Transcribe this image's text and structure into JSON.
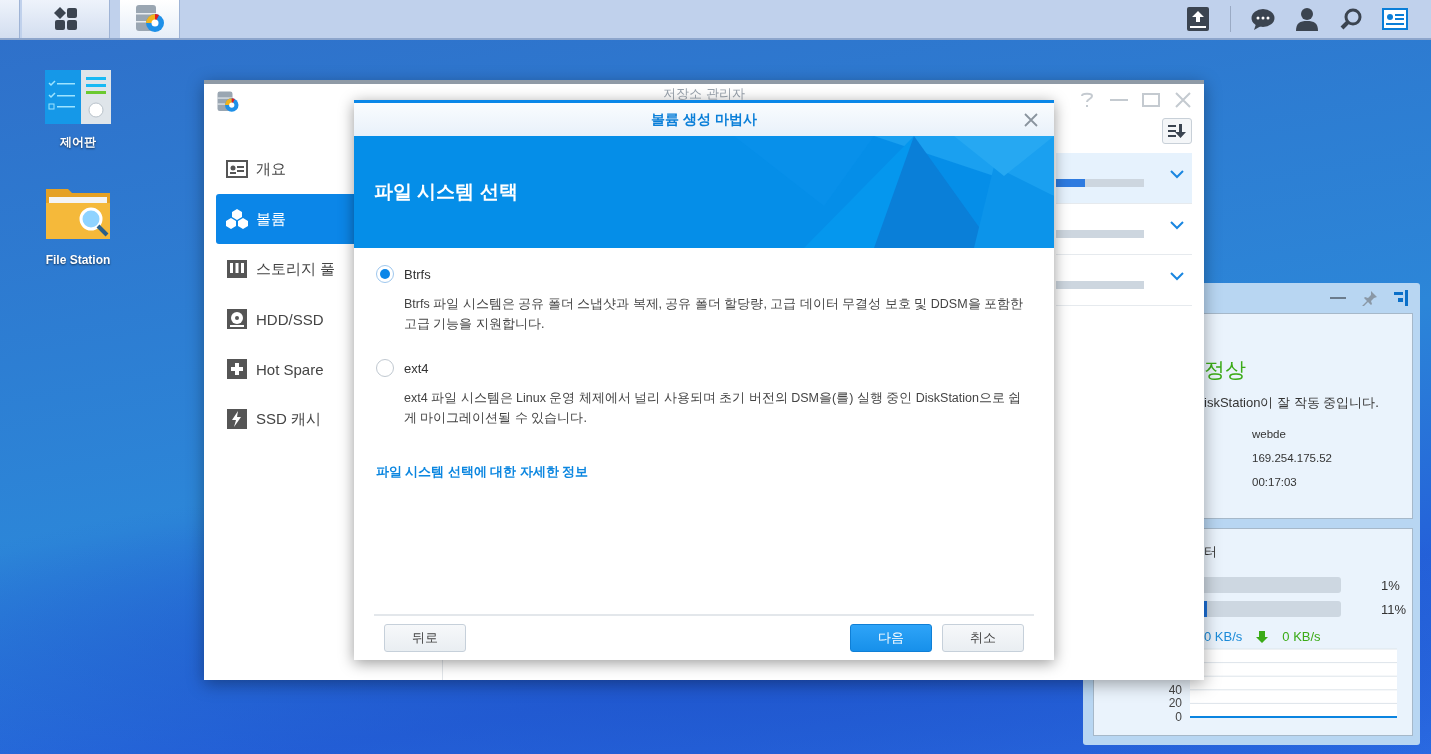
{
  "desktop_icons": [
    {
      "kind": "control-panel",
      "label": "제어판"
    },
    {
      "kind": "file-station",
      "label": "File Station"
    }
  ],
  "storage_window": {
    "title": "저장소 관리자",
    "sidebar": [
      {
        "kind": "overview",
        "label": "개요",
        "selected": false
      },
      {
        "kind": "volume",
        "label": "볼륨",
        "selected": true
      },
      {
        "kind": "pool",
        "label": "스토리지 풀",
        "selected": false
      },
      {
        "kind": "hdd",
        "label": "HDD/SSD",
        "selected": false
      },
      {
        "kind": "spare",
        "label": "Hot Spare",
        "selected": false
      },
      {
        "kind": "cache",
        "label": "SSD 캐시",
        "selected": false
      }
    ],
    "volumes": [
      {
        "level": 0.33,
        "selected": true
      },
      {
        "selected": false
      },
      {
        "selected": false
      }
    ]
  },
  "wizard": {
    "title": "볼륨 생성 마법사",
    "heading": "파일 시스템 선택",
    "options": [
      {
        "label": "Btrfs",
        "selected": true,
        "description": "Btrfs 파일 시스템은 공유 폴더 스냅샷과 복제, 공유 폴더 할당량, 고급 데이터 무결성 보호 및 DDSM을 포함한 고급 기능을 지원합니다."
      },
      {
        "label": "ext4",
        "selected": false,
        "description": "ext4 파일 시스템은 Linux 운영 체제에서 널리 사용되며 초기 버전의 DSM을(를) 실행 중인 DiskStation으로 쉽게 마이그레이션될 수 있습니다."
      }
    ],
    "link": "파일 시스템 선택에 대한 자세한 정보",
    "buttons": [
      {
        "kind": "secondary",
        "label": "뒤로"
      },
      {
        "kind": "primary",
        "label": "다음"
      },
      {
        "kind": "secondary",
        "label": "취소"
      }
    ]
  },
  "widget": {
    "status": "정상",
    "message": "iskStation이 잘 작동 중입니다.",
    "info": [
      "webde",
      "169.254.175.52",
      "00:17:03"
    ],
    "monitor_title": "터",
    "meters": [
      {
        "level": 0.01,
        "reading": "1%"
      },
      {
        "level": 0.11,
        "reading": "11%"
      }
    ],
    "upload": "0 KB/s",
    "download": "0 KB/s",
    "chart_data": {
      "type": "line",
      "ylim": [
        0,
        100
      ],
      "yticks": [
        0,
        20,
        40
      ],
      "series": [
        {
          "color": "#0a84e0",
          "values": [
            0,
            0,
            0,
            0,
            0,
            0,
            0,
            0,
            0,
            0
          ]
        }
      ]
    }
  }
}
